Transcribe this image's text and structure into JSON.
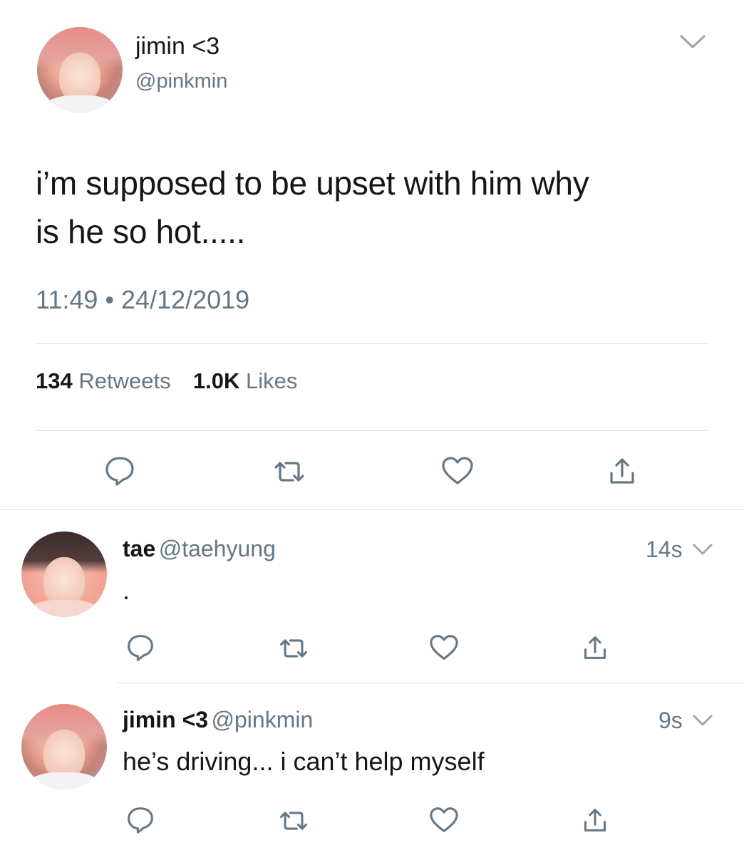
{
  "main_tweet": {
    "author_name": "jimin <3",
    "author_handle": "@pinkmin",
    "text_line1": "i’m supposed to be upset with him why",
    "text_line2": "is he so hot.....",
    "timestamp": "11:49 • 24/12/2019",
    "retweets_count": "134",
    "retweets_label": "Retweets",
    "likes_count": "1.0K",
    "likes_label": "Likes"
  },
  "replies": [
    {
      "author_name": "tae",
      "author_handle": "@taehyung",
      "time": "14s",
      "text": "."
    },
    {
      "author_name": "jimin <3",
      "author_handle": "@pinkmin",
      "time": "9s",
      "text": "he’s driving... i can’t help myself"
    }
  ],
  "icons": {
    "reply": "reply-bubble-icon",
    "retweet": "retweet-icon",
    "like": "heart-icon",
    "share": "share-icon",
    "more": "chevron-down-icon"
  },
  "colors": {
    "text_primary": "#14171a",
    "text_secondary": "#657786",
    "divider": "#d9dfe3"
  }
}
